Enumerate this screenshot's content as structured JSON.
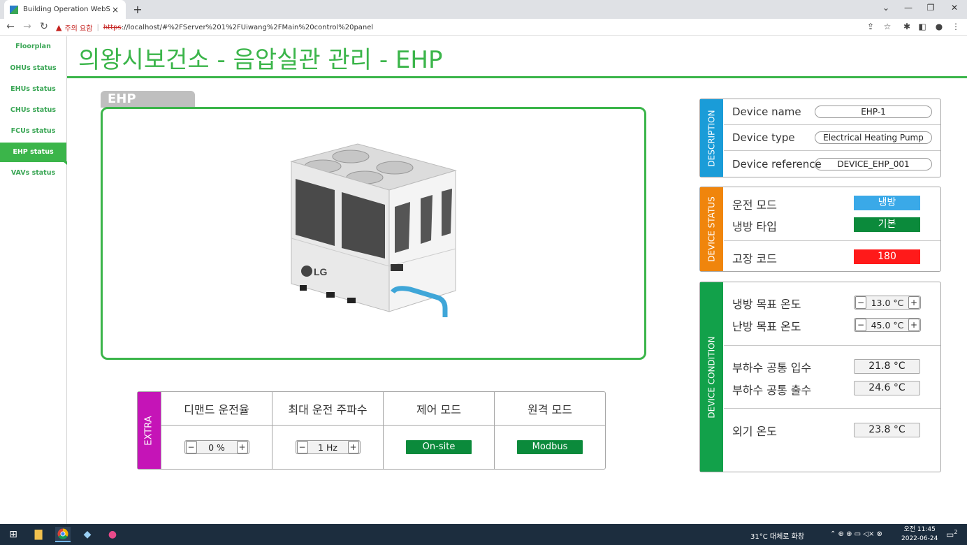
{
  "browser": {
    "tab_title": "Building Operation WebStation",
    "tab_close": "×",
    "new_tab": "+",
    "warning_label": "주의 요함",
    "url_protocol": "https",
    "url_rest": "://localhost/#%2FServer%201%2FUiwang%2FMain%20control%20panel",
    "window_controls": [
      "⌄",
      "—",
      "❐",
      "✕"
    ]
  },
  "sidebar": {
    "items": [
      {
        "label": "Floorplan"
      },
      {
        "label": "OHUs status"
      },
      {
        "label": "EHUs status"
      },
      {
        "label": "CHUs status"
      },
      {
        "label": "FCUs status"
      },
      {
        "label": "EHP status"
      },
      {
        "label": "VAVs status"
      }
    ],
    "active_index": 5
  },
  "page": {
    "title": "의왕시보건소 - 음압실관 관리 - EHP",
    "image_tab_label": "EHP",
    "image_logo": "LG"
  },
  "extra": {
    "side_label": "EXTRA",
    "columns": [
      {
        "header": "디맨드 운전율",
        "value": "0 %"
      },
      {
        "header": "최대 운전 주파수",
        "value": "1 Hz"
      },
      {
        "header": "제어 모드",
        "value": "On-site"
      },
      {
        "header": "원격 모드",
        "value": "Modbus"
      }
    ],
    "minus": "−",
    "plus": "+"
  },
  "description": {
    "side_label": "DESCRIPTION",
    "rows": [
      {
        "label": "Device name",
        "value": "EHP-1"
      },
      {
        "label": "Device type",
        "value": "Electrical Heating Pump"
      },
      {
        "label": "Device reference",
        "value": "DEVICE_EHP_001"
      }
    ]
  },
  "device_status": {
    "side_label": "DEVICE STATUS",
    "operation_mode_label": "운전 모드",
    "operation_mode_value": "냉방",
    "cooling_type_label": "냉방 타입",
    "cooling_type_value": "기본",
    "fault_code_label": "고장 코드",
    "fault_code_value": "180"
  },
  "device_condition": {
    "side_label": "DEVICE CONDITION",
    "cooling_target_label": "냉방 목표 온도",
    "cooling_target_value": "13.0 °C",
    "heating_target_label": "난방 목표 온도",
    "heating_target_value": "45.0 °C",
    "load_water_in_label": "부하수 공통 입수",
    "load_water_in_value": "21.8 °C",
    "load_water_out_label": "부하수 공통 출수",
    "load_water_out_value": "24.6 °C",
    "outdoor_temp_label": "외기 온도",
    "outdoor_temp_value": "23.8 °C"
  },
  "taskbar": {
    "weather": "31°C  대체로 화창",
    "time": "오전 11:45",
    "date": "2022-06-24",
    "notification_count": "2"
  },
  "colors": {
    "brand_green": "#3bb54a",
    "description_blue": "#1a9cd8",
    "status_orange": "#f0850c",
    "condition_green": "#12a14a",
    "extra_magenta": "#c514b7",
    "cooling_mode_blue": "#3aa9e8",
    "fault_red": "#ff1a1a"
  }
}
